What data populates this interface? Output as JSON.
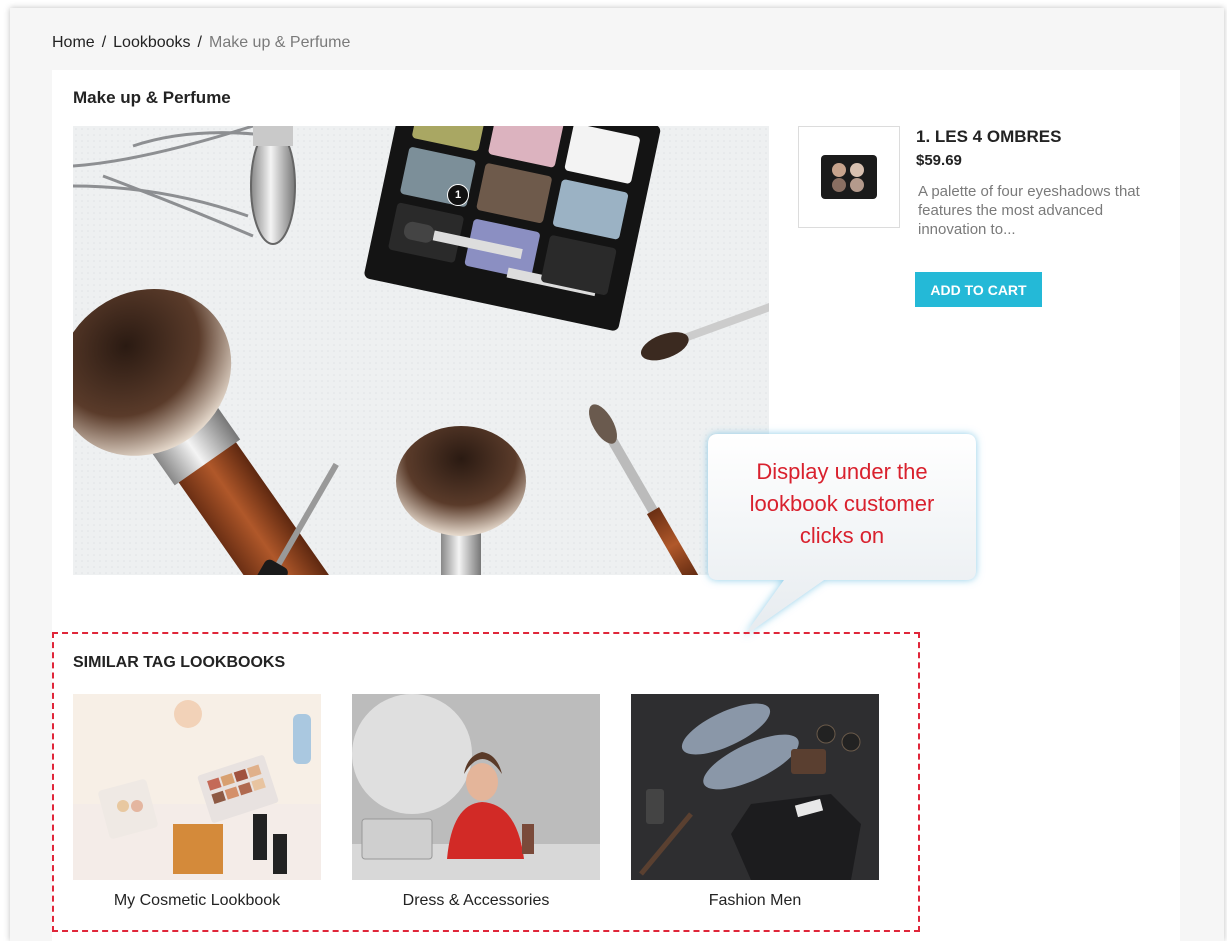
{
  "breadcrumb": {
    "home": "Home",
    "lookbooks": "Lookbooks",
    "current": "Make up & Perfume",
    "separator": "/"
  },
  "page": {
    "title": "Make up & Perfume"
  },
  "hotspot": {
    "number": "1"
  },
  "product": {
    "name": "1. LES 4 OMBRES",
    "price": "$59.69",
    "description": "A palette of four eyeshadows that features the most advanced innovation to...",
    "add_to_cart": "ADD TO CART"
  },
  "callout": {
    "line1": "Display under the",
    "line2": "lookbook customer",
    "line3": "clicks on"
  },
  "similar": {
    "title": "SIMILAR TAG LOOKBOOKS",
    "items": [
      {
        "label": "My Cosmetic Lookbook"
      },
      {
        "label": "Dress & Accessories"
      },
      {
        "label": "Fashion Men"
      }
    ]
  },
  "colors": {
    "accent": "#24b9d7",
    "callout_text": "#d9212e",
    "dashed_border": "#e0263a"
  }
}
